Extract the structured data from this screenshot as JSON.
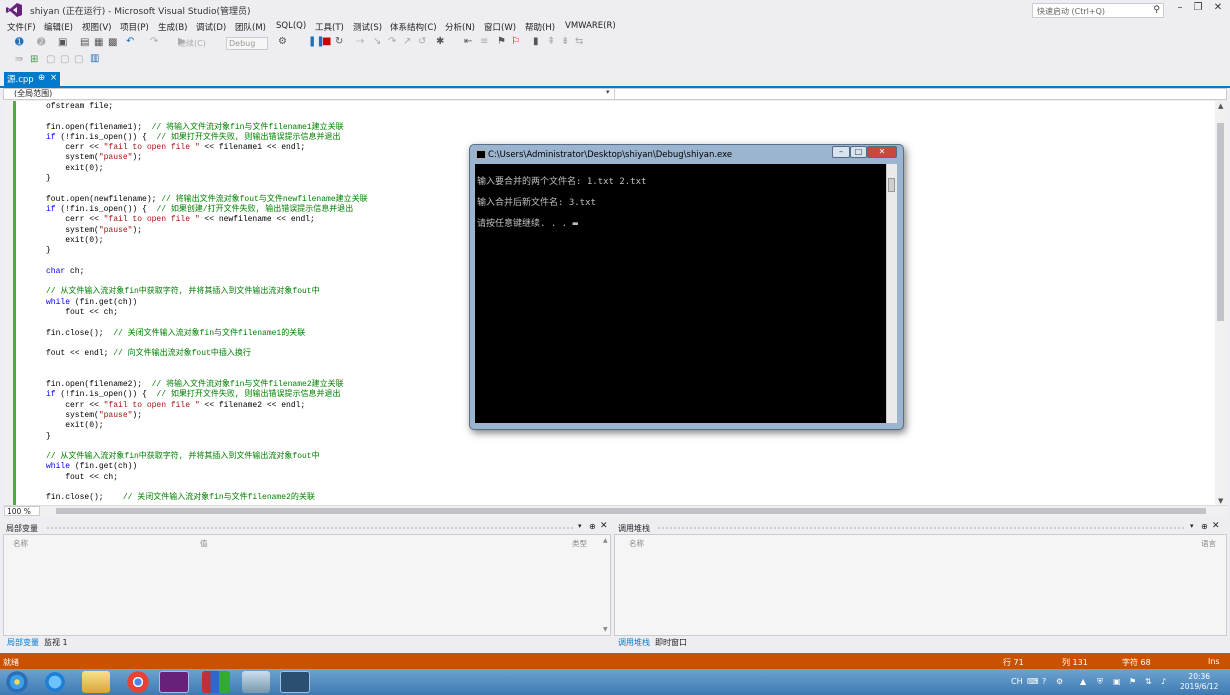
{
  "window": {
    "title": "shiyan (正在运行) - Microsoft Visual Studio(管理员)",
    "quick_launch_placeholder": "快速启动 (Ctrl+Q)"
  },
  "menu": [
    "文件(F)",
    "编辑(E)",
    "视图(V)",
    "项目(P)",
    "生成(B)",
    "调试(D)",
    "团队(M)",
    "SQL(Q)",
    "工具(T)",
    "测试(S)",
    "体系结构(C)",
    "分析(N)",
    "窗口(W)",
    "帮助(H)",
    "VMWARE(R)"
  ],
  "toolbar": {
    "continue_label": "继续(C)",
    "config_value": "Debug"
  },
  "tab": {
    "label": "源.cpp",
    "pin": "⊕",
    "close": "×"
  },
  "navbar": {
    "scope": "(全局范围)"
  },
  "editor": {
    "lines": [
      [
        [
          "ofstream file;",
          ""
        ]
      ],
      [
        [
          "",
          ""
        ]
      ],
      [
        [
          "fin.open(filename1);  ",
          ""
        ],
        [
          "// 将输入文件流对象fin与文件filename1建立关联",
          "cm"
        ]
      ],
      [
        [
          "if",
          "kw"
        ],
        [
          " (!fin.is_open()) {  ",
          ""
        ],
        [
          "// 如果打开文件失败, 则输出错误提示信息并退出",
          "cm"
        ]
      ],
      [
        [
          "    cerr << ",
          ""
        ],
        [
          "\"fail to open file \"",
          "st"
        ],
        [
          " << filename1 << endl;",
          ""
        ]
      ],
      [
        [
          "    system(",
          ""
        ],
        [
          "\"pause\"",
          "st"
        ],
        [
          ");",
          ""
        ]
      ],
      [
        [
          "    exit(0);",
          ""
        ]
      ],
      [
        [
          "}",
          ""
        ]
      ],
      [
        [
          "",
          ""
        ]
      ],
      [
        [
          "fout.open(newfilename); ",
          ""
        ],
        [
          "// 将输出文件流对象fout与文件newfilename建立关联",
          "cm"
        ]
      ],
      [
        [
          "if",
          "kw"
        ],
        [
          " (!fin.is_open()) {  ",
          ""
        ],
        [
          "// 如果创建/打开文件失败, 输出错误提示信息并退出",
          "cm"
        ]
      ],
      [
        [
          "    cerr << ",
          ""
        ],
        [
          "\"fail to open file \"",
          "st"
        ],
        [
          " << newfilename << endl;",
          ""
        ]
      ],
      [
        [
          "    system(",
          ""
        ],
        [
          "\"pause\"",
          "st"
        ],
        [
          ");",
          ""
        ]
      ],
      [
        [
          "    exit(0);",
          ""
        ]
      ],
      [
        [
          "}",
          ""
        ]
      ],
      [
        [
          "",
          ""
        ]
      ],
      [
        [
          "char",
          "kw"
        ],
        [
          " ch;",
          ""
        ]
      ],
      [
        [
          "",
          ""
        ]
      ],
      [
        [
          "// 从文件输入流对象fin中获取字符, 并将其插入到文件输出流对象fout中",
          "cm"
        ]
      ],
      [
        [
          "while",
          "kw"
        ],
        [
          " (fin.get(ch))",
          ""
        ]
      ],
      [
        [
          "    fout << ch;",
          ""
        ]
      ],
      [
        [
          "",
          ""
        ]
      ],
      [
        [
          "fin.close();  ",
          ""
        ],
        [
          "// 关闭文件输入流对象fin与文件filename1的关联",
          "cm"
        ]
      ],
      [
        [
          "",
          ""
        ]
      ],
      [
        [
          "fout << endl; ",
          ""
        ],
        [
          "// 向文件输出流对象fout中插入换行",
          "cm"
        ]
      ],
      [
        [
          "",
          ""
        ]
      ],
      [
        [
          "",
          ""
        ]
      ],
      [
        [
          "fin.open(filename2);  ",
          ""
        ],
        [
          "// 将输入文件流对象fin与文件filename2建立关联",
          "cm"
        ]
      ],
      [
        [
          "if",
          "kw"
        ],
        [
          " (!fin.is_open()) {  ",
          ""
        ],
        [
          "// 如果打开文件失败, 则输出错误提示信息并退出",
          "cm"
        ]
      ],
      [
        [
          "    cerr << ",
          ""
        ],
        [
          "\"fail to open file \"",
          "st"
        ],
        [
          " << filename2 << endl;",
          ""
        ]
      ],
      [
        [
          "    system(",
          ""
        ],
        [
          "\"pause\"",
          "st"
        ],
        [
          ");",
          ""
        ]
      ],
      [
        [
          "    exit(0);",
          ""
        ]
      ],
      [
        [
          "}",
          ""
        ]
      ],
      [
        [
          "",
          ""
        ]
      ],
      [
        [
          "// 从文件输入流对象fin中获取字符, 并将其插入到文件输出流对象fout中",
          "cm"
        ]
      ],
      [
        [
          "while",
          "kw"
        ],
        [
          " (fin.get(ch))",
          ""
        ]
      ],
      [
        [
          "    fout << ch;",
          ""
        ]
      ],
      [
        [
          "",
          ""
        ]
      ],
      [
        [
          "fin.close();    ",
          ""
        ],
        [
          "// 关闭文件输入流对象fin与文件filename2的关联",
          "cm"
        ]
      ]
    ],
    "zoom": "100 %"
  },
  "console": {
    "title": "C:\\Users\\Administrator\\Desktop\\shiyan\\Debug\\shiyan.exe",
    "lines": [
      "输入要合并的两个文件名: 1.txt 2.txt",
      "输入合并后新文件名: 3.txt",
      "请按任意键继续. . . ▬"
    ]
  },
  "locals_pane": {
    "title": "局部变量",
    "columns": [
      "名称",
      "值",
      "类型"
    ],
    "tabs": [
      "局部变量",
      "监视 1"
    ]
  },
  "callstack_pane": {
    "title": "调用堆栈",
    "columns": [
      "名称",
      "语言"
    ],
    "tabs": [
      "调用堆栈",
      "即时窗口"
    ]
  },
  "statusbar": {
    "ready": "就绪",
    "row": "行 71",
    "col": "列 131",
    "char": "字符 68",
    "mode": "Ins"
  },
  "taskbar": {
    "time": "20:36",
    "date": "2019/6/12",
    "lang": "CH"
  },
  "colors": {
    "accent": "#007acc",
    "status": "#ca5100"
  }
}
